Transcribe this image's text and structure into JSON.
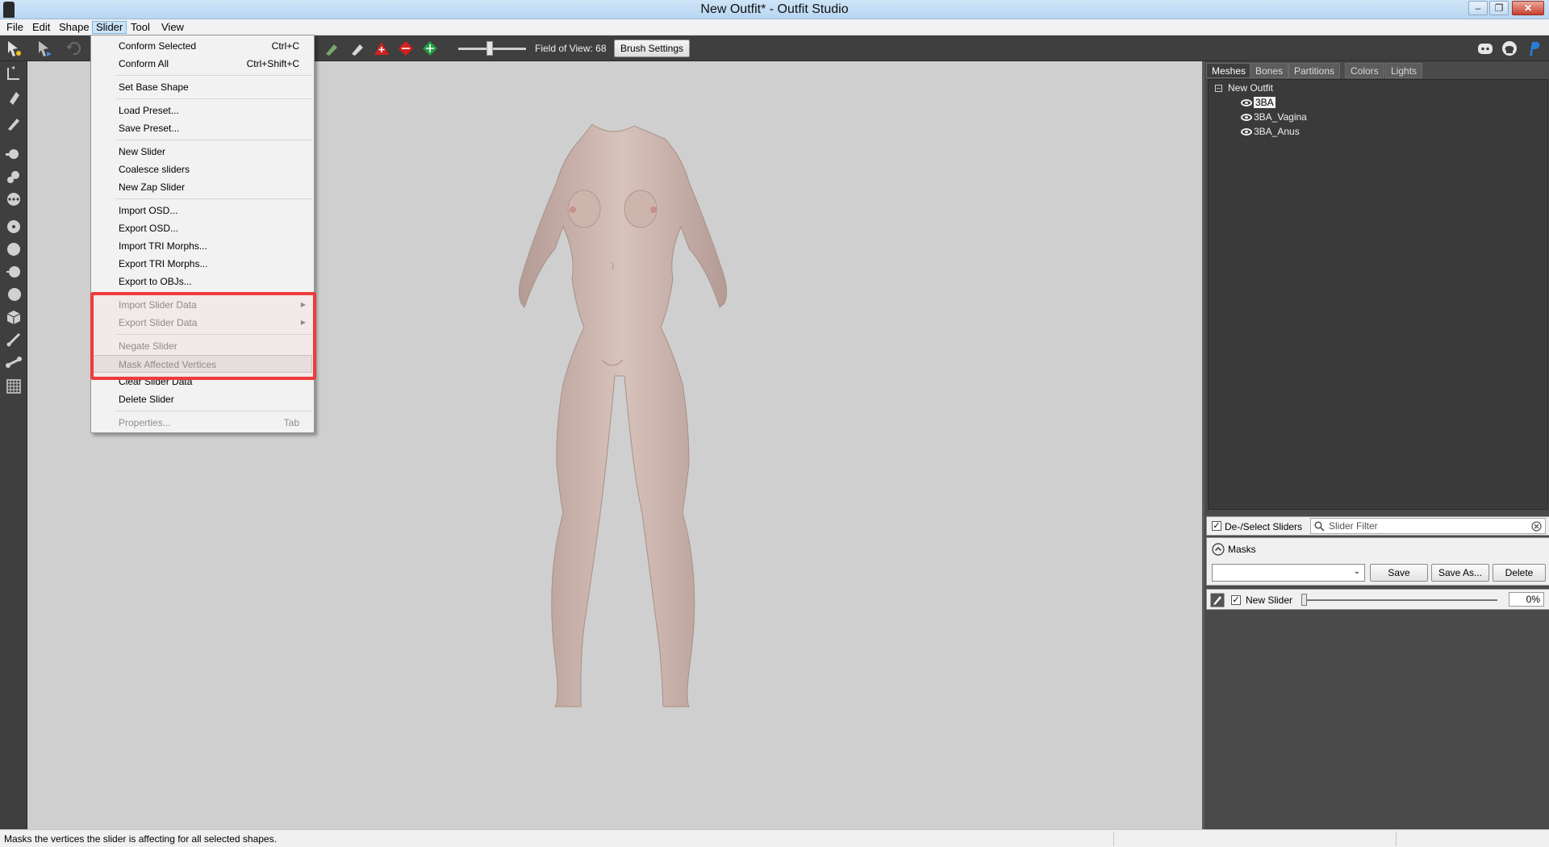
{
  "window": {
    "title": "New Outfit* - Outfit Studio",
    "minimize_icon": "minimize-icon",
    "maximize_icon": "restore-icon",
    "close_icon": "close-icon"
  },
  "menubar": {
    "file": "File",
    "edit": "Edit",
    "shape": "Shape",
    "slider": "Slider",
    "tool": "Tool",
    "view": "View"
  },
  "toolbar": {
    "fov_label": "Field of View: 68",
    "brush_settings": "Brush Settings"
  },
  "slider_menu": {
    "conform_selected": "Conform Selected",
    "conform_selected_sc": "Ctrl+C",
    "conform_all": "Conform All",
    "conform_all_sc": "Ctrl+Shift+C",
    "set_base_shape": "Set Base Shape",
    "load_preset": "Load Preset...",
    "save_preset": "Save Preset...",
    "new_slider": "New Slider",
    "coalesce_sliders": "Coalesce sliders",
    "new_zap_slider": "New Zap Slider",
    "import_osd": "Import OSD...",
    "export_osd": "Export OSD...",
    "import_tri": "Import TRI Morphs...",
    "export_tri": "Export TRI Morphs...",
    "export_objs": "Export to OBJs...",
    "import_slider_data": "Import Slider Data",
    "export_slider_data": "Export Slider Data",
    "negate_slider": "Negate Slider",
    "mask_affected": "Mask Affected Vertices",
    "clear_slider_data": "Clear Slider Data",
    "delete_slider": "Delete Slider",
    "properties": "Properties...",
    "properties_sc": "Tab"
  },
  "right_panel": {
    "tabs": [
      "Meshes",
      "Bones",
      "Partitions",
      "Colors",
      "Lights"
    ],
    "tree": {
      "root": "New Outfit",
      "items": [
        "3BA",
        "3BA_Vagina",
        "3BA_Anus"
      ]
    },
    "deselect_sliders": "De-/Select Sliders",
    "slider_filter_placeholder": "Slider Filter",
    "masks_label": "Masks",
    "save": "Save",
    "save_as": "Save As...",
    "delete": "Delete",
    "slider_name": "New Slider",
    "slider_value": "0%"
  },
  "status": {
    "text": "Masks the vertices the slider is affecting for all selected shapes."
  }
}
